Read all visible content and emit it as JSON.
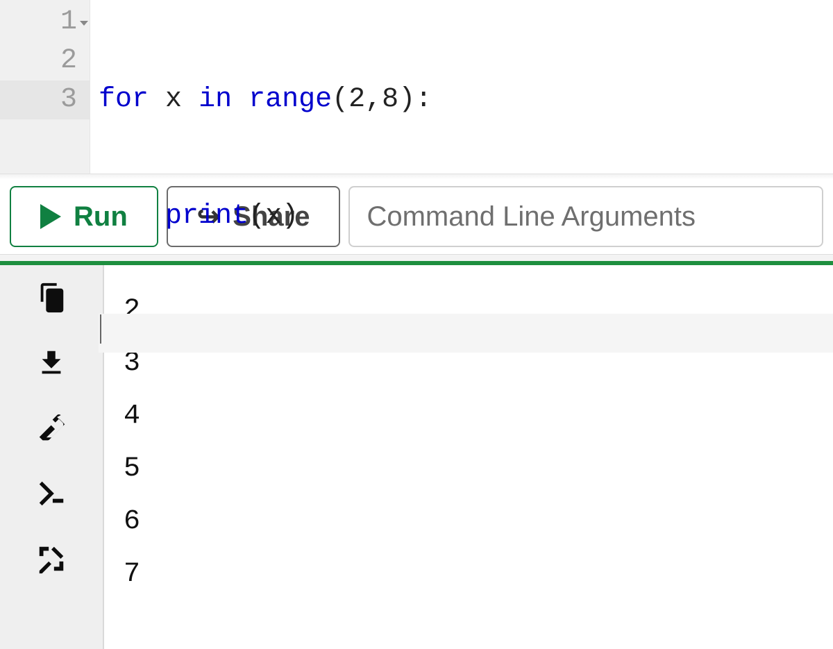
{
  "code": {
    "lines": [
      "1",
      "2",
      "3"
    ],
    "active_line": 3,
    "fold_lines": [
      1
    ],
    "tokens": {
      "l1": {
        "kw1": "for",
        "sp1": " ",
        "var1": "x",
        "sp2": " ",
        "kw2": "in",
        "sp3": " ",
        "func1": "range",
        "p1": "(",
        "n1": "2",
        "p2": ",",
        "n2": "8",
        "p3": ")",
        "p4": ":"
      },
      "l2": {
        "indent": "    ",
        "func": "print",
        "p1": "(",
        "var": "x",
        "p2": ")"
      }
    }
  },
  "toolbar": {
    "run_label": "Run",
    "share_label": "Share",
    "cli_placeholder": "Command Line Arguments",
    "cli_value": ""
  },
  "output_lines": [
    "2",
    "3",
    "4",
    "5",
    "6",
    "7"
  ]
}
